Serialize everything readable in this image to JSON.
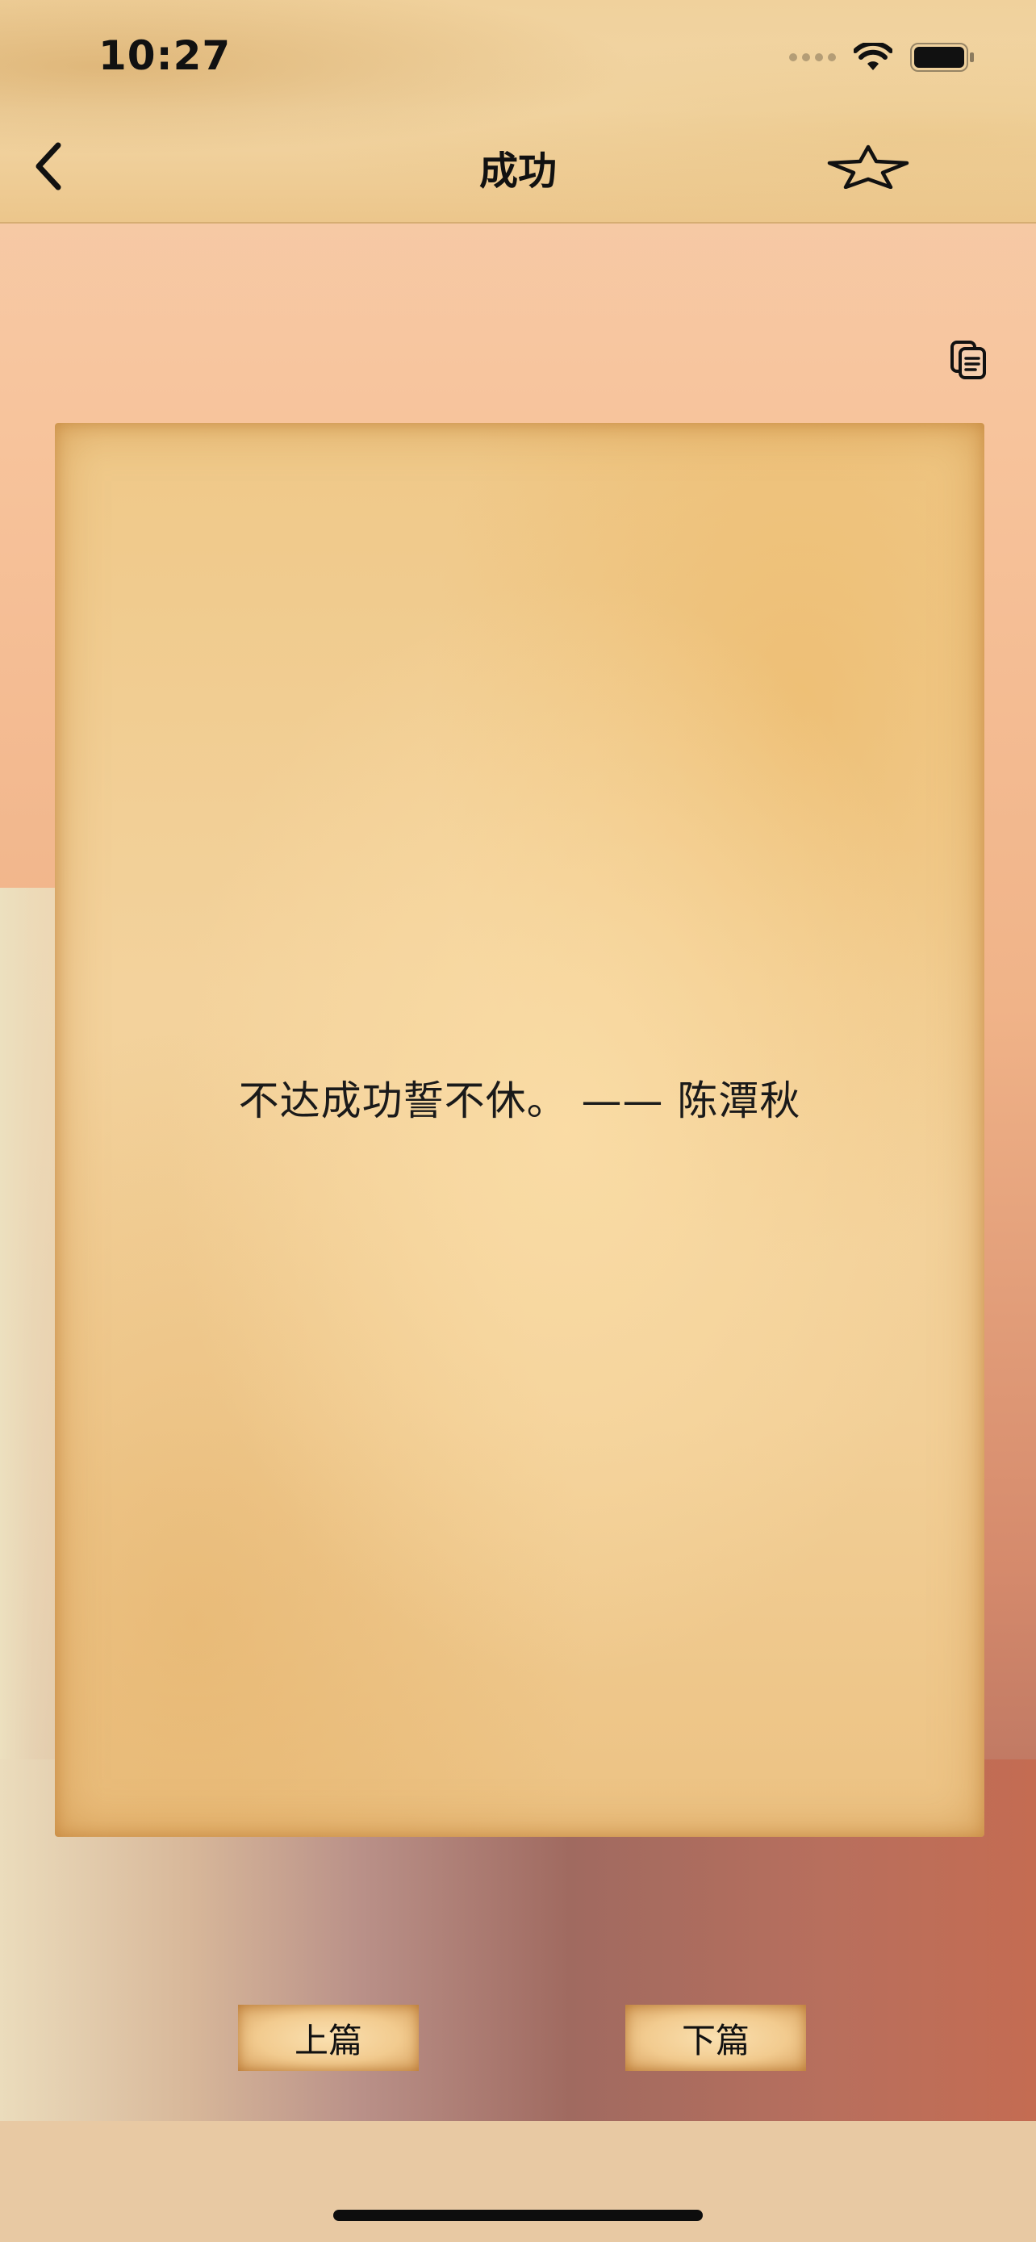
{
  "status_bar": {
    "time": "10:27"
  },
  "nav": {
    "title": "成功",
    "back_icon": "chevron-left-icon",
    "favorite_icon": "star-outline-icon"
  },
  "toolbar": {
    "copy_icon": "copy-document-icon"
  },
  "content": {
    "quote": "不达成功誓不休。 —— 陈潭秋"
  },
  "pager": {
    "prev_label": "上篇",
    "next_label": "下篇"
  },
  "colors": {
    "background_top": "#f6cfae",
    "background_bottom": "#c77053",
    "paper": "#f2cf97",
    "text": "#111111"
  }
}
